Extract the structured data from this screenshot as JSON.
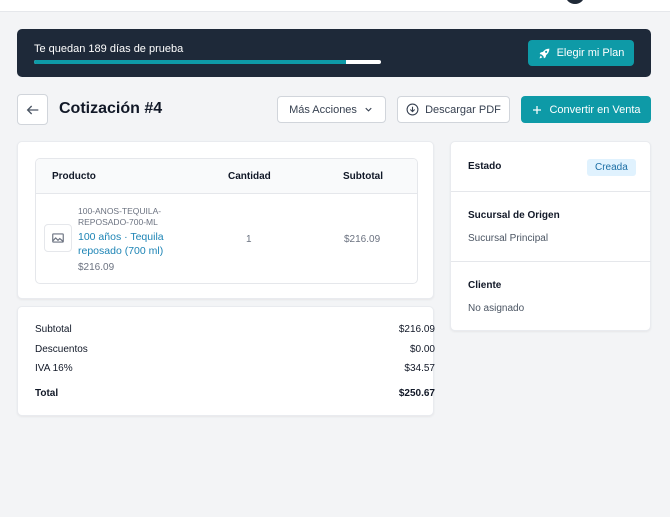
{
  "trial": {
    "text": "Te quedan 189 días de prueba",
    "progress": 0.9,
    "plan_button": "Elegir mi Plan",
    "plan_icon": "rocket-icon"
  },
  "header": {
    "title": "Cotización #4",
    "back_icon": "arrow-left-icon",
    "more_actions": "Más Acciones",
    "download_pdf": "Descargar PDF",
    "convert": "Convertir en Venta"
  },
  "items_table": {
    "columns": {
      "product": "Producto",
      "quantity": "Cantidad",
      "subtotal": "Subtotal"
    },
    "rows": [
      {
        "sku": "100-ANOS-TEQUILA-REPOSADO-700-ML",
        "name": "100 años · Tequila reposado (700 ml)",
        "price": "$216.09",
        "quantity": "1",
        "subtotal": "$216.09"
      }
    ]
  },
  "summary": {
    "subtotal_label": "Subtotal",
    "subtotal_value": "$216.09",
    "discounts_label": "Descuentos",
    "discounts_value": "$0.00",
    "tax_label": "IVA 16%",
    "tax_value": "$34.57",
    "total_label": "Total",
    "total_value": "$250.67"
  },
  "side": {
    "status_label": "Estado",
    "status_value": "Creada",
    "branch_label": "Sucursal de Origen",
    "branch_value": "Sucursal Principal",
    "client_label": "Cliente",
    "client_value": "No asignado"
  },
  "colors": {
    "accent": "#0e9aa7",
    "banner": "#1e2939",
    "link": "#1d84b5"
  }
}
